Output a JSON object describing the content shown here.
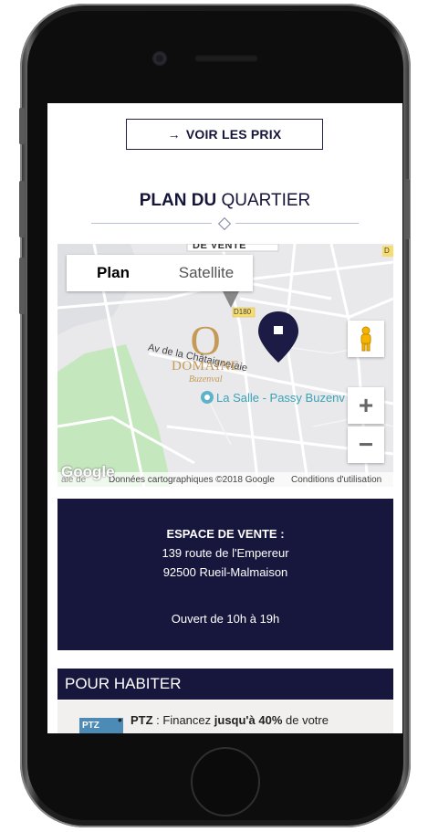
{
  "page": {
    "voir_prix_label": "VOIR LES PRIX",
    "voir_prix_arrow": "→",
    "section_title_bold": "PLAN DU",
    "section_title_rest": " QUARTIER"
  },
  "map": {
    "type_active": "Plan",
    "type_inactive": "Satellite",
    "label_de_vente": "DE VENTE",
    "road_label": "D180",
    "road_label_small": "D",
    "street_label": "Av de la Châtaigneraie",
    "poi_label": "La Salle - Passy Buzenv",
    "domaine_name": "DOMAINE",
    "domaine_sub": "Buzenval",
    "zoom_in": "+",
    "zoom_out": "−",
    "google_logo": "Google",
    "footer_left": "ale de",
    "footer_copy": "Données cartographiques ©2018 Google",
    "footer_terms": "Conditions d'utilisation"
  },
  "vente": {
    "title": "ESPACE DE VENTE :",
    "address_line1": "139 route de l'Empereur",
    "address_line2": "92500 Rueil-Malmaison",
    "hours": "Ouvert de 10h à 19h"
  },
  "habiter": {
    "title": "POUR HABITER",
    "badge": "PTZ",
    "ptz_label": "PTZ",
    "ptz_text_a": " : Financez ",
    "ptz_text_bold": "jusqu'à 40%",
    "ptz_text_b": " de votre"
  },
  "colors": {
    "navy": "#17173d",
    "map_pin": "#1b1b45",
    "park_green": "#c4e7bd",
    "gold": "#c49a56"
  }
}
